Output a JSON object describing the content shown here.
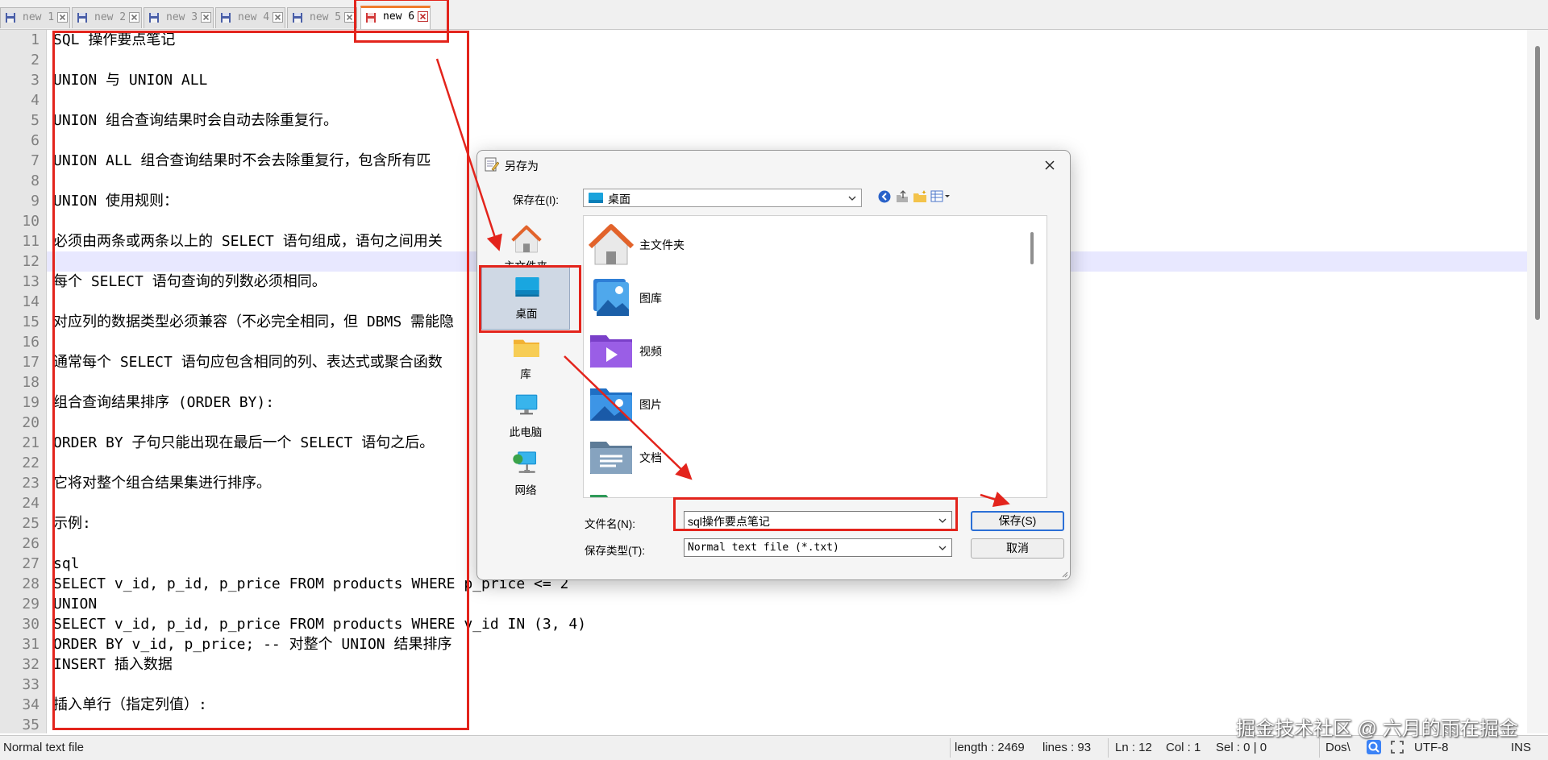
{
  "tabs": [
    {
      "label": "new 1",
      "active": false
    },
    {
      "label": "new 2",
      "active": false
    },
    {
      "label": "new 3",
      "active": false
    },
    {
      "label": "new 4",
      "active": false
    },
    {
      "label": "new 5",
      "active": false
    },
    {
      "label": "new 6",
      "active": true
    }
  ],
  "editor": {
    "current_line": 12,
    "lines": [
      "SQL 操作要点笔记",
      "",
      "UNION 与 UNION ALL",
      "",
      "UNION 组合查询结果时会自动去除重复行。",
      "",
      "UNION ALL 组合查询结果时不会去除重复行，包含所有匹",
      "",
      "UNION 使用规则：",
      "",
      "必须由两条或两条以上的 SELECT 语句组成，语句之间用关",
      "",
      "每个 SELECT 语句查询的列数必须相同。",
      "",
      "对应列的数据类型必须兼容（不必完全相同，但 DBMS 需能隐",
      "",
      "通常每个 SELECT 语句应包含相同的列、表达式或聚合函数",
      "",
      "组合查询结果排序 (ORDER BY):",
      "",
      "ORDER BY 子句只能出现在最后一个 SELECT 语句之后。",
      "",
      "它将对整个组合结果集进行排序。",
      "",
      "示例:",
      "",
      "sql",
      "SELECT v_id, p_id, p_price FROM products WHERE p_price <= 2",
      "UNION",
      "SELECT v_id, p_id, p_price FROM products WHERE v_id IN (3, 4)",
      "ORDER BY v_id, p_price; -- 对整个 UNION 结果排序",
      "INSERT 插入数据",
      "",
      "插入单行（指定列值）:",
      ""
    ]
  },
  "status_bar": {
    "file_type": "Normal text file",
    "length": "length : 2469",
    "lines": "lines : 93",
    "ln": "Ln : 12",
    "col": "Col : 1",
    "sel": "Sel : 0 | 0",
    "eol": "Dos\\",
    "encoding": "UTF-8",
    "mode": "INS"
  },
  "watermark": "掘金技术社区 @ 六月的雨在掘金",
  "dialog": {
    "title": "另存为",
    "save_in_label": "保存在(I):",
    "save_in_value": "桌面",
    "places": [
      {
        "label": "主文件夹",
        "icon": "home-icon"
      },
      {
        "label": "桌面",
        "icon": "desktop-icon",
        "selected": true
      },
      {
        "label": "库",
        "icon": "library-folder-icon"
      },
      {
        "label": "此电脑",
        "icon": "computer-icon"
      },
      {
        "label": "网络",
        "icon": "network-icon"
      }
    ],
    "files": [
      {
        "label": "主文件夹",
        "icon": "home-icon"
      },
      {
        "label": "图库",
        "icon": "gallery-icon"
      },
      {
        "label": "视频",
        "icon": "videos-folder-icon"
      },
      {
        "label": "图片",
        "icon": "pictures-folder-icon"
      },
      {
        "label": "文档",
        "icon": "documents-folder-icon"
      }
    ],
    "filename_label": "文件名(N):",
    "filename_value": "sql操作要点笔记",
    "filetype_label": "保存类型(T):",
    "filetype_value": "Normal text file (*.txt)",
    "save_button": "保存(S)",
    "cancel_button": "取消"
  },
  "colors": {
    "annotation_red": "#e3241c",
    "current_line_bg": "#e8e8ff",
    "primary_button_border": "#2b6fd6"
  }
}
